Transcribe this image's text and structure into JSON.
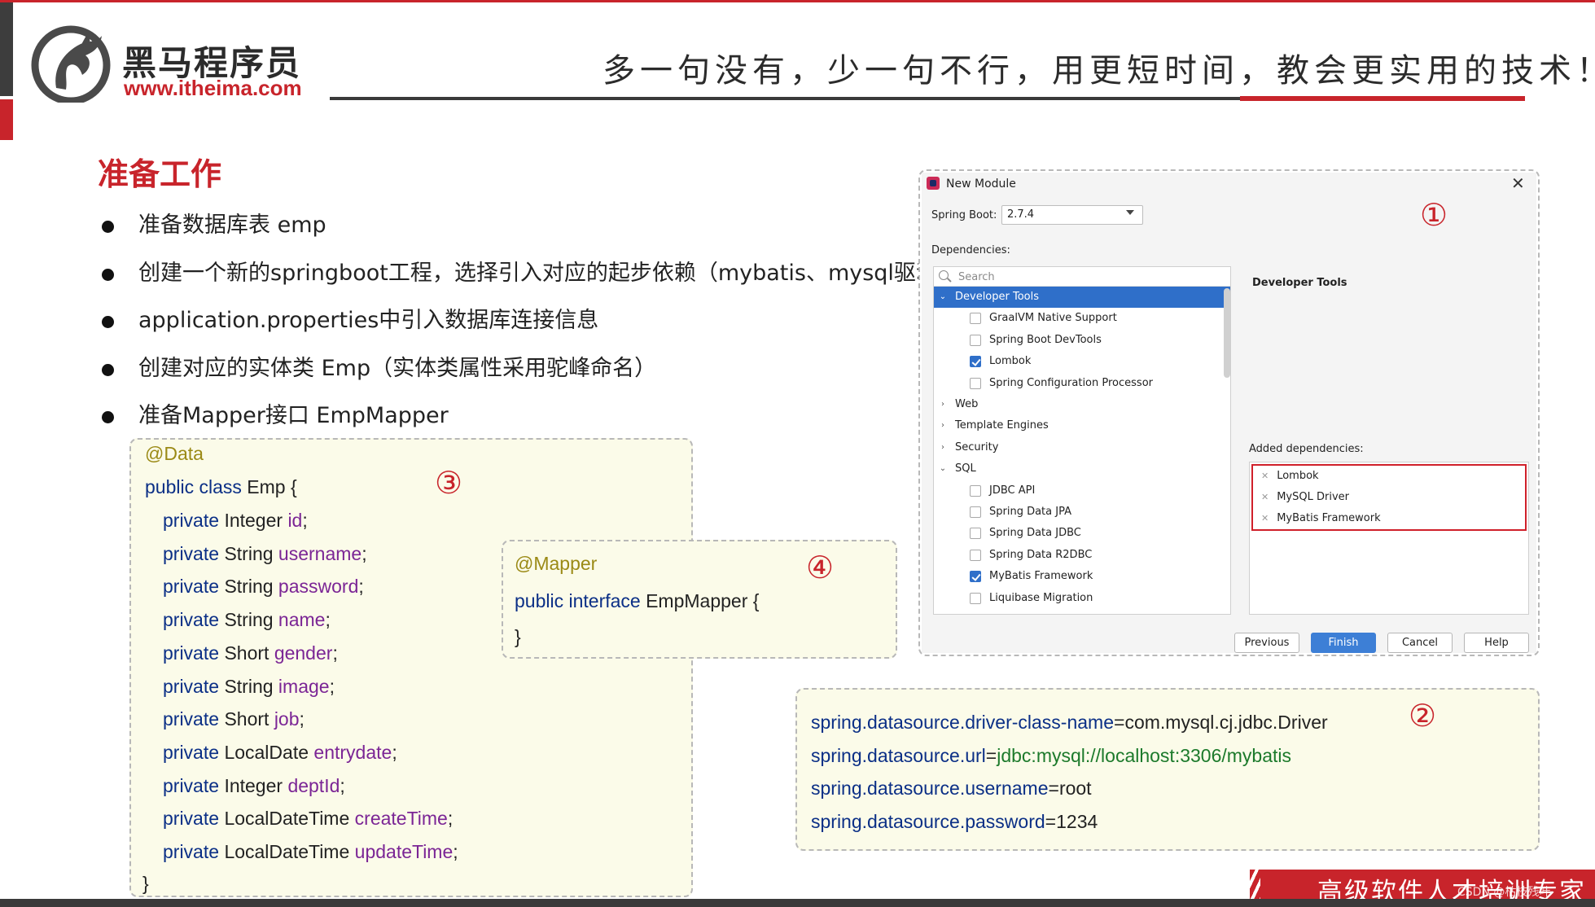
{
  "header": {
    "logo_name": "黑马程序员",
    "logo_url": "www.itheima.com",
    "slogan": "多一句没有，少一句不行，用更短时间，教会更实用的技术！"
  },
  "section_title": "准备工作",
  "bullets": [
    "准备数据库表 emp",
    "创建一个新的springboot工程，选择引入对应的起步依赖（mybatis、mysql驱动、lombok）",
    "application.properties中引入数据库连接信息",
    "创建对应的实体类 Emp（实体类属性采用驼峰命名）",
    "准备Mapper接口 EmpMapper"
  ],
  "emp_code": {
    "annotation": "@Data",
    "kw_public_class": "public class",
    "class_name": " Emp {",
    "kw_private": "private",
    "fields": [
      {
        "type": "Integer",
        "name": "id"
      },
      {
        "type": "String",
        "name": "username"
      },
      {
        "type": "String",
        "name": "password"
      },
      {
        "type": "String",
        "name": "name"
      },
      {
        "type": "Short",
        "name": "gender"
      },
      {
        "type": "String",
        "name": "image"
      },
      {
        "type": "Short",
        "name": "job"
      },
      {
        "type": "LocalDate",
        "name": "entrydate"
      },
      {
        "type": "Integer",
        "name": "deptId"
      },
      {
        "type": "LocalDateTime",
        "name": "createTime"
      },
      {
        "type": "LocalDateTime",
        "name": "updateTime"
      }
    ],
    "semicolon": ";",
    "close": "}",
    "marker": "③"
  },
  "mapper_code": {
    "annotation": "@Mapper",
    "kw_public_interface": "public interface",
    "name": " EmpMapper {",
    "close": "}",
    "marker": "④"
  },
  "props_code": {
    "marker": "②",
    "eq": "=",
    "lines": [
      {
        "key": "spring.datasource.driver-class-name",
        "value": "com.mysql.cj.jdbc.Driver"
      },
      {
        "key": "spring.datasource.url",
        "value": "jdbc:mysql://localhost:3306/mybatis"
      },
      {
        "key": "spring.datasource.username",
        "value": "root"
      },
      {
        "key": "spring.datasource.password",
        "value": "1234"
      }
    ]
  },
  "dialog": {
    "title": "New Module",
    "close": "✕",
    "marker": "①",
    "spring_boot_label": "Spring Boot:",
    "spring_boot_version": "2.7.4",
    "dependencies_label": "Dependencies:",
    "search_placeholder": "Search",
    "tree": {
      "developer_tools": "Developer Tools",
      "dev_items": [
        {
          "label": "GraalVM Native Support",
          "checked": false
        },
        {
          "label": "Spring Boot DevTools",
          "checked": false
        },
        {
          "label": "Lombok",
          "checked": true
        },
        {
          "label": "Spring Configuration Processor",
          "checked": false
        }
      ],
      "web": "Web",
      "template_engines": "Template Engines",
      "security": "Security",
      "sql": "SQL",
      "sql_items": [
        {
          "label": "JDBC API",
          "checked": false
        },
        {
          "label": "Spring Data JPA",
          "checked": false
        },
        {
          "label": "Spring Data JDBC",
          "checked": false
        },
        {
          "label": "Spring Data R2DBC",
          "checked": false
        },
        {
          "label": "MyBatis Framework",
          "checked": true
        },
        {
          "label": "Liquibase Migration",
          "checked": false
        }
      ]
    },
    "right_heading": "Developer Tools",
    "added_label": "Added dependencies:",
    "added": [
      "Lombok",
      "MySQL Driver",
      "MyBatis Framework"
    ],
    "remove_glyph": "✕",
    "buttons": {
      "previous": "Previous",
      "finish": "Finish",
      "cancel": "Cancel",
      "help": "Help"
    },
    "accent": "#2f6fc9"
  },
  "footer": {
    "banner": "高级软件人才培训专家",
    "watermark": "CSDN @枯枝残叶"
  },
  "colors": {
    "brand_red": "#c8242b",
    "keyword_blue": "#0b2f86",
    "field_purple": "#7b2595",
    "value_green": "#1c7a2b",
    "annotation_olive": "#9b8a16"
  }
}
